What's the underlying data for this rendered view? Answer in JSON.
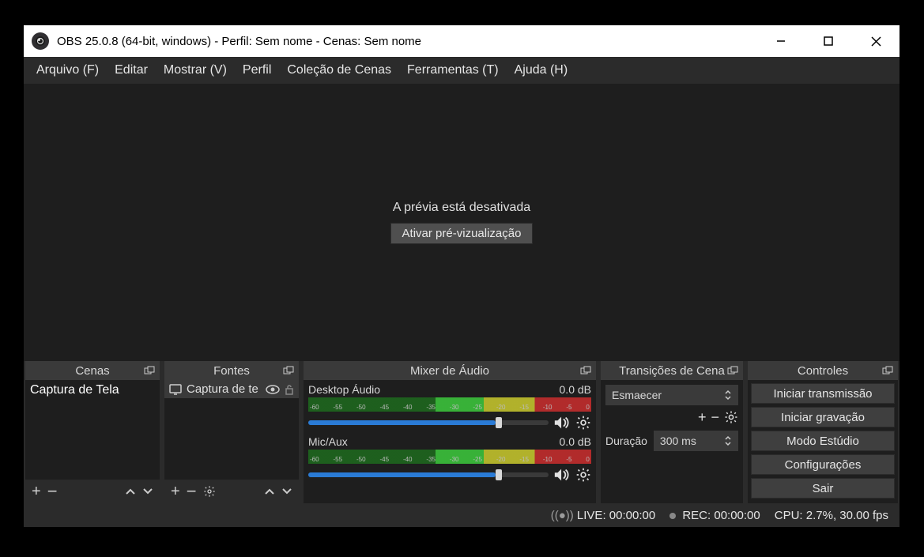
{
  "window": {
    "title": "OBS 25.0.8 (64-bit, windows) - Perfil: Sem nome - Cenas: Sem nome"
  },
  "menu": {
    "arquivo": "Arquivo (F)",
    "editar": "Editar",
    "mostrar": "Mostrar (V)",
    "perfil": "Perfil",
    "colecao": "Coleção de Cenas",
    "ferramentas": "Ferramentas (T)",
    "ajuda": "Ajuda (H)"
  },
  "preview": {
    "disabled_text": "A prévia está desativada",
    "enable_button": "Ativar pré-vizualização"
  },
  "docks": {
    "scenes": {
      "title": "Cenas",
      "item": "Captura de Tela"
    },
    "sources": {
      "title": "Fontes",
      "item": "Captura de te"
    },
    "mixer": {
      "title": "Mixer de Áudio",
      "ch1_name": "Desktop Áudio",
      "ch1_db": "0.0 dB",
      "ch2_name": "Mic/Aux",
      "ch2_db": "0.0 dB"
    },
    "transitions": {
      "title": "Transições de Cena",
      "selected": "Esmaecer",
      "duration_label": "Duração",
      "duration_value": "300 ms"
    },
    "controls": {
      "title": "Controles",
      "start_stream": "Iniciar transmissão",
      "start_record": "Iniciar gravação",
      "studio_mode": "Modo Estúdio",
      "settings": "Configurações",
      "exit": "Sair"
    }
  },
  "status": {
    "live": "LIVE: 00:00:00",
    "rec": "REC: 00:00:00",
    "cpu": "CPU: 2.7%, 30.00 fps"
  }
}
